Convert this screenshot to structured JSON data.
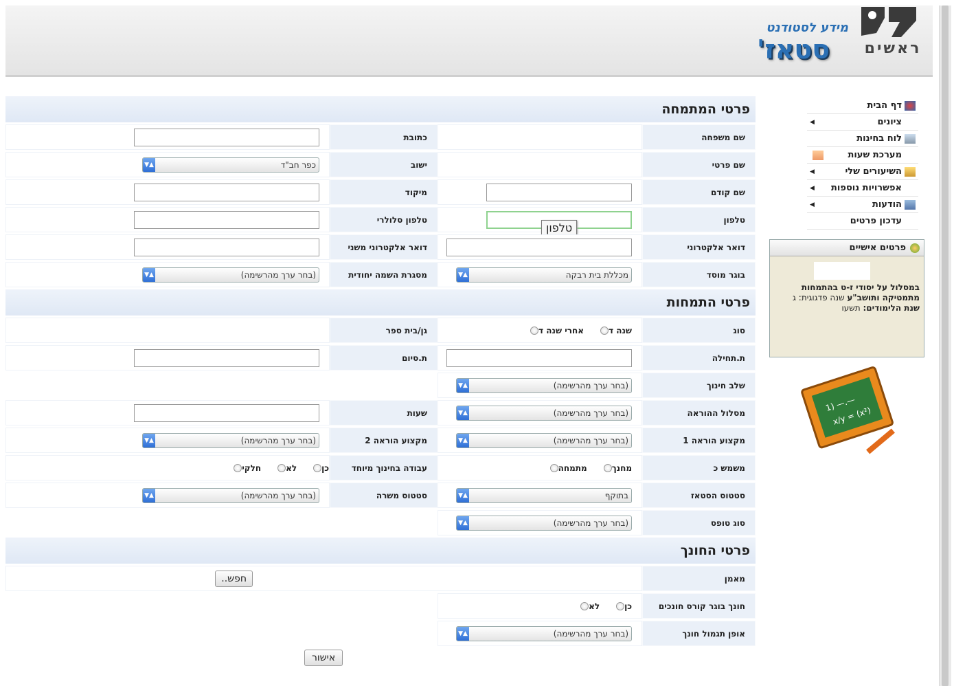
{
  "header": {
    "logo_text": "ראשים",
    "brand_sub": "מידע לסטודנט",
    "brand_main": "סטאז'"
  },
  "form": {
    "section_personal": "פרטי המתמחה",
    "section_internship": "פרטי התמחות",
    "section_mentor": "פרטי החונך",
    "personal": {
      "last_name_label": "שם משפחה",
      "address_label": "כתובת",
      "first_name_label": "שם פרטי",
      "city_label": "ישוב",
      "city_value": "כפר חב\"ד",
      "prev_name_label": "שם קודם",
      "zip_label": "מיקוד",
      "phone_label": "טלפון",
      "phone_tooltip": "טלפון",
      "mobile_label": "טלפון סלולרי",
      "email_label": "דואר אלקטרוני",
      "email2_label": "דואר אלקטרוני משני",
      "institution_label": "בוגר מוסד",
      "institution_value": "מכללת בית רבקה",
      "special_framework_label": "מסגרת השמה יחודית",
      "special_framework_value": "(בחר ערך מהרשימה)"
    },
    "internship": {
      "type_label": "סוג",
      "type_options": [
        "שנה ד",
        "אחרי שנה ד"
      ],
      "school_label": "גן/בית ספר",
      "start_label": "ת.תחילה",
      "end_label": "ת.סיום",
      "stage_label": "שלב חינוך",
      "stage_value": "(בחר ערך מהרשימה)",
      "track_label": "מסלול ההוראה",
      "track_value": "(בחר ערך מהרשימה)",
      "hours_label": "שעות",
      "subject1_label": "מקצוע הוראה 1",
      "subject1_value": "(בחר ערך מהרשימה)",
      "subject2_label": "מקצוע הוראה 2",
      "subject2_value": "(בחר ערך מהרשימה)",
      "serves_as_label": "משמש כ",
      "serves_as_options": [
        "מחנך",
        "מתמחה"
      ],
      "special_ed_label": "עבודה בחינוך מיוחד",
      "special_ed_options": [
        "כן",
        "לא",
        "חלקי"
      ],
      "status_label": "סטטוס הסטאז",
      "status_value": "בתוקף",
      "job_status_label": "סטטוס משרה",
      "job_status_value": "(בחר ערך מהרשימה)",
      "form_type_label": "סוג טופס",
      "form_type_value": "(בחר ערך מהרשימה)"
    },
    "mentor": {
      "trainer_label": "מאמן",
      "search_button": "חפש..",
      "course_grad_label": "חונך בוגר קורס חונכים",
      "course_grad_options": [
        "כן",
        "לא"
      ],
      "reward_label": "אופן תגמול חונך",
      "reward_value": "(בחר ערך מהרשימה)"
    },
    "submit_button": "אישור"
  },
  "sidebar": {
    "items": [
      {
        "label": "דף הבית",
        "icon": "home-icon",
        "submenu": false
      },
      {
        "label": "ציונים",
        "icon": "",
        "submenu": true
      },
      {
        "label": "לוח בחינות",
        "icon": "exam-board-icon",
        "submenu": false
      },
      {
        "label": "מערכת שעות",
        "icon": "timetable-icon",
        "submenu": false
      },
      {
        "label": "השיעורים שלי",
        "icon": "lessons-icon",
        "submenu": true
      },
      {
        "label": "אפשרויות נוספות",
        "icon": "",
        "submenu": true
      },
      {
        "label": "הודעות",
        "icon": "messages-icon",
        "submenu": true
      },
      {
        "label": "עדכון פרטים",
        "icon": "",
        "submenu": false
      }
    ]
  },
  "personal_box": {
    "title": "פרטים אישיים",
    "line1": "במסלול על יסודי ז-ט בהתמחות",
    "line2_bold": "מתמטיקה ותושב\"ע",
    "line2_rest": " שנה פדגוגית: ג",
    "line3_bold": "שנת הלימודים:",
    "line3_rest": " תשעו"
  },
  "colors": {
    "brand_blue": "#2a6fb4",
    "section_bg": "#dfe8f5",
    "label_bg": "#eaf0f8",
    "personal_box_bg": "#eeead8"
  }
}
